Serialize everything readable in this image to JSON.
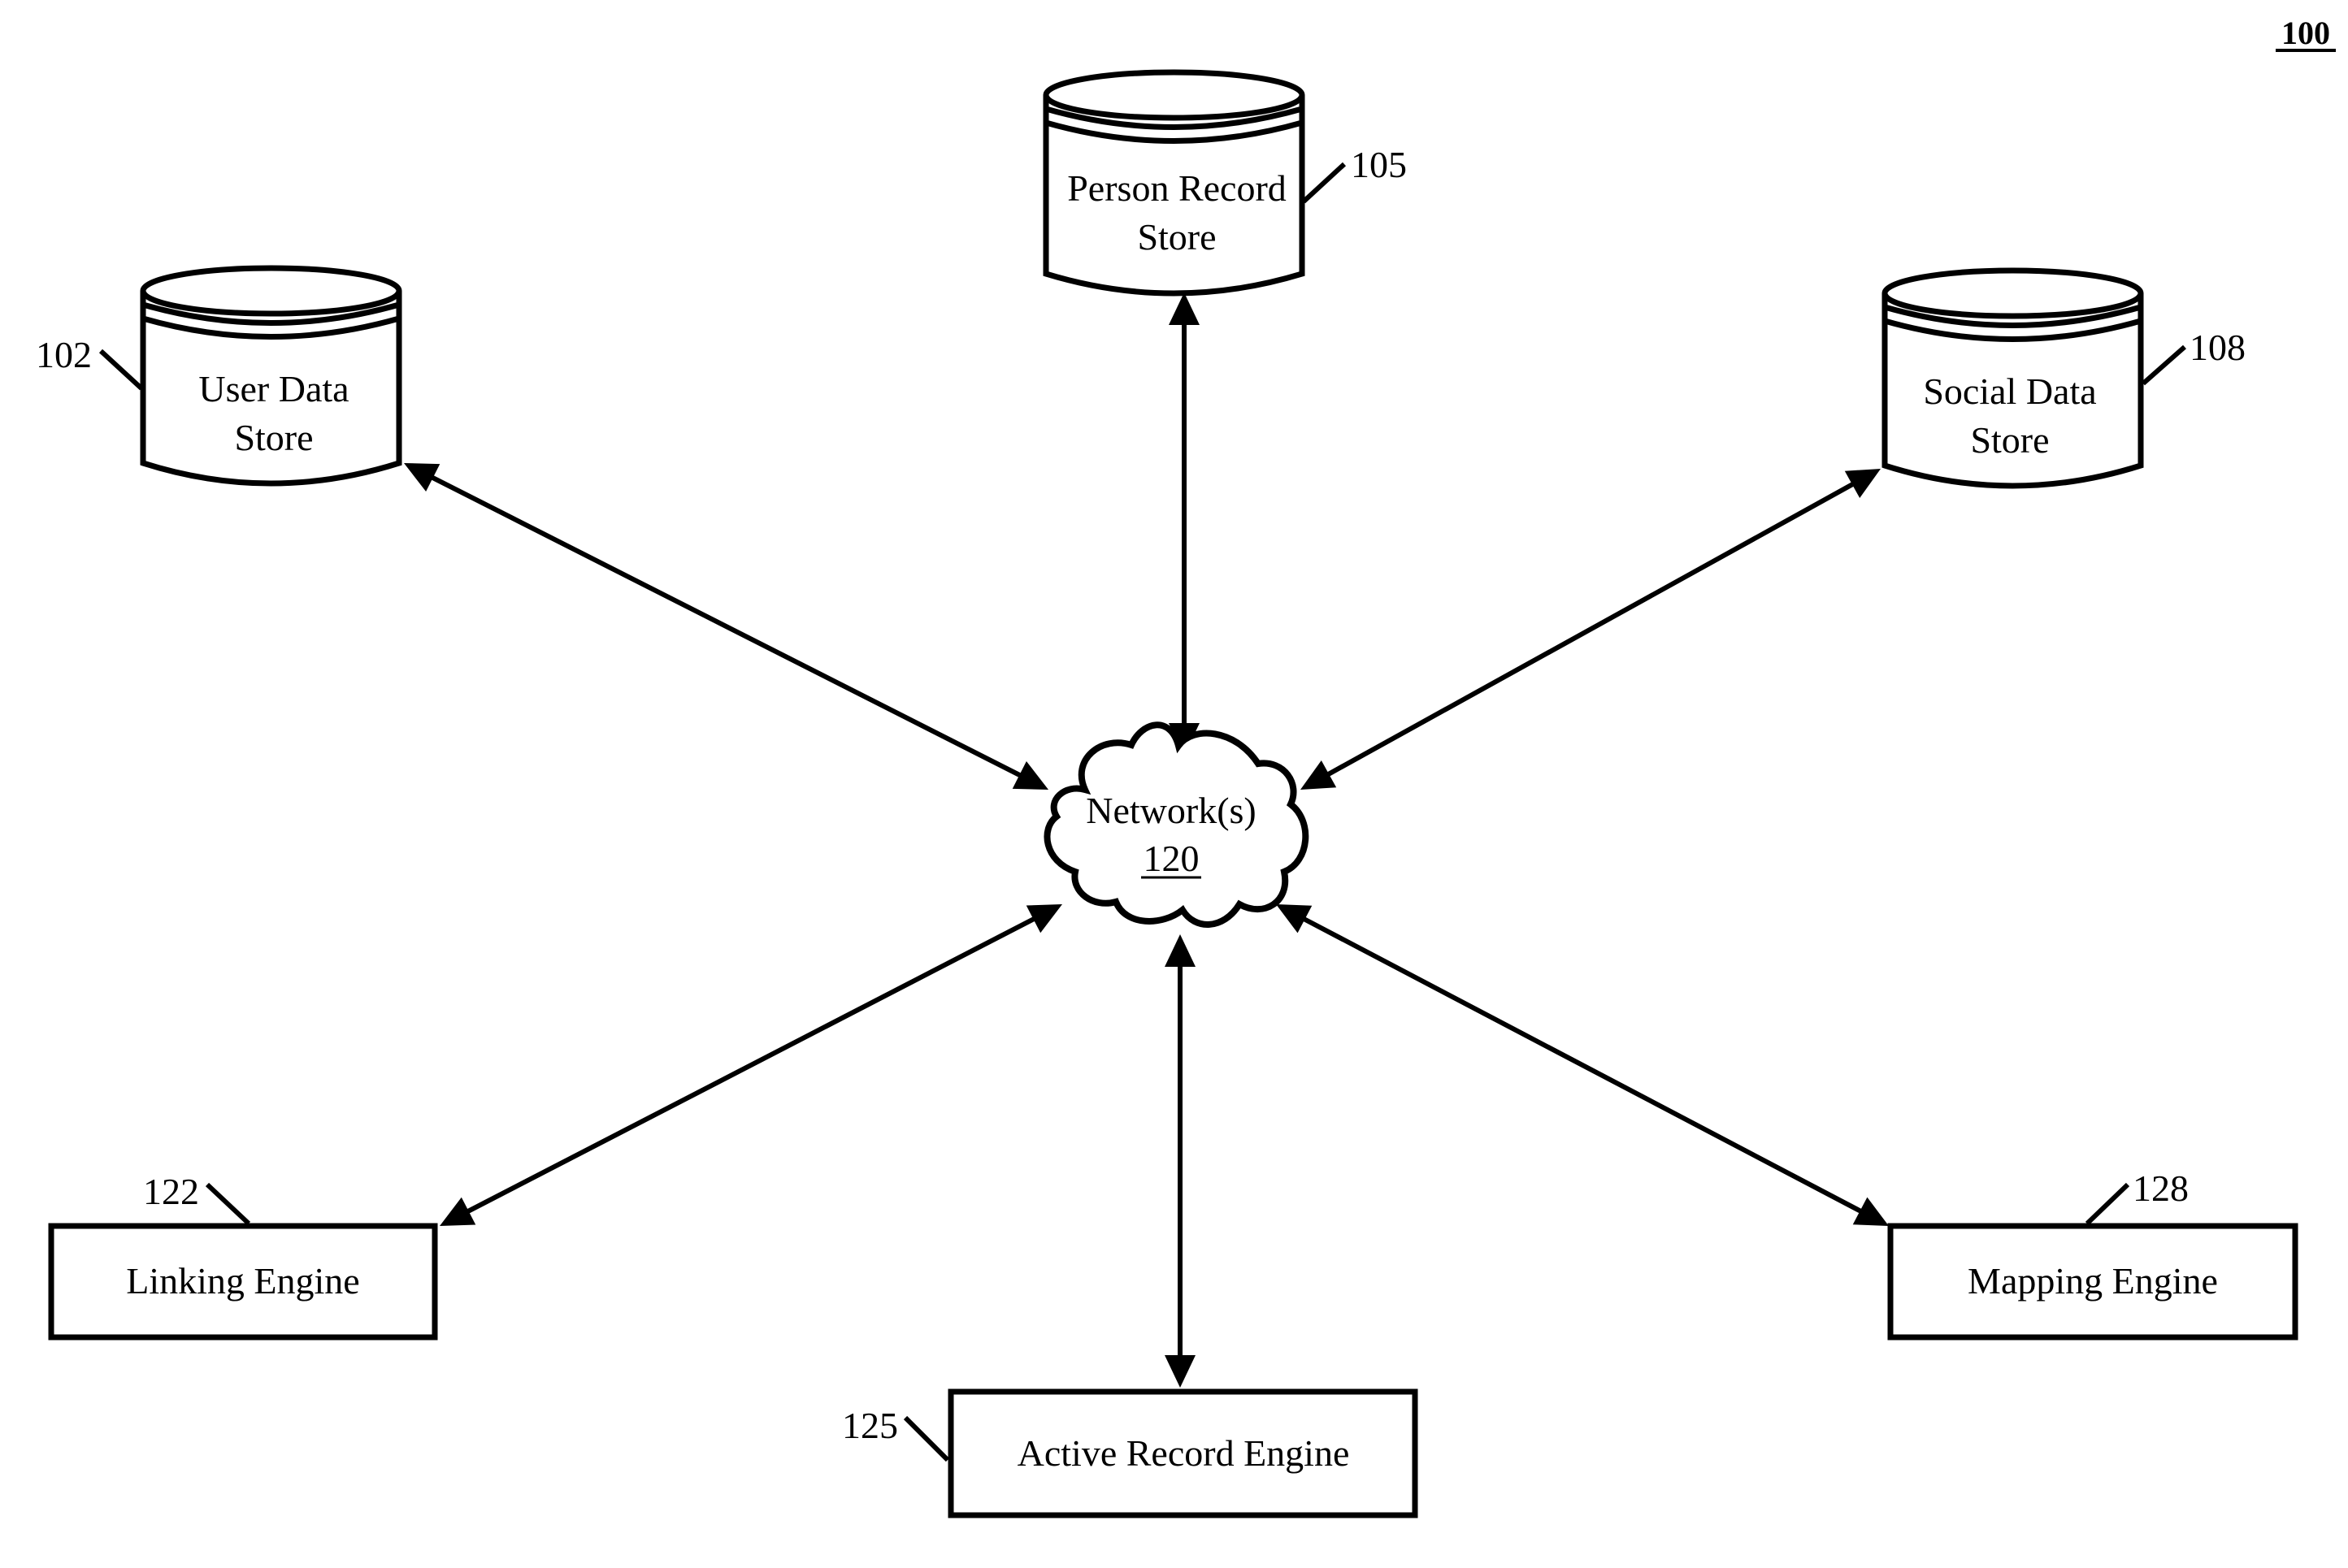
{
  "figure": {
    "number": "100"
  },
  "nodes": {
    "user_data_store": {
      "line1": "User Data",
      "line2": "Store",
      "ref": "102",
      "shape": "database-cylinder"
    },
    "person_record_store": {
      "line1": "Person Record",
      "line2": "Store",
      "ref": "105",
      "shape": "database-cylinder"
    },
    "social_data_store": {
      "line1": "Social Data",
      "line2": "Store",
      "ref": "108",
      "shape": "database-cylinder"
    },
    "network": {
      "line1": "Network(s)",
      "ref": "120",
      "shape": "cloud"
    },
    "linking_engine": {
      "label": "Linking Engine",
      "ref": "122",
      "shape": "rectangle"
    },
    "active_record_engine": {
      "label": "Active Record Engine",
      "ref": "125",
      "shape": "rectangle"
    },
    "mapping_engine": {
      "label": "Mapping Engine",
      "ref": "128",
      "shape": "rectangle"
    }
  },
  "edges": [
    {
      "from": "user_data_store",
      "to": "network",
      "direction": "bidirectional"
    },
    {
      "from": "person_record_store",
      "to": "network",
      "direction": "bidirectional"
    },
    {
      "from": "social_data_store",
      "to": "network",
      "direction": "bidirectional"
    },
    {
      "from": "linking_engine",
      "to": "network",
      "direction": "bidirectional"
    },
    {
      "from": "active_record_engine",
      "to": "network",
      "direction": "bidirectional"
    },
    {
      "from": "mapping_engine",
      "to": "network",
      "direction": "bidirectional"
    }
  ]
}
